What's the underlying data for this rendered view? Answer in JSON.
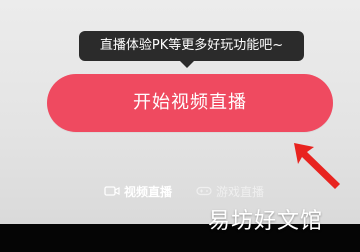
{
  "tooltip": {
    "text": "直播体验PK等更多好玩功能吧~"
  },
  "start_button": {
    "label": "开始视频直播",
    "color": "#ef4a60"
  },
  "annotation": {
    "icon": "red-arrow-icon",
    "color": "#e8231f"
  },
  "tabs": [
    {
      "label": "视频直播",
      "icon": "video-camera-icon",
      "active": true
    },
    {
      "label": "游戏直播",
      "icon": "gamepad-icon",
      "active": false
    }
  ],
  "watermark": {
    "text": "易坊好文馆"
  }
}
